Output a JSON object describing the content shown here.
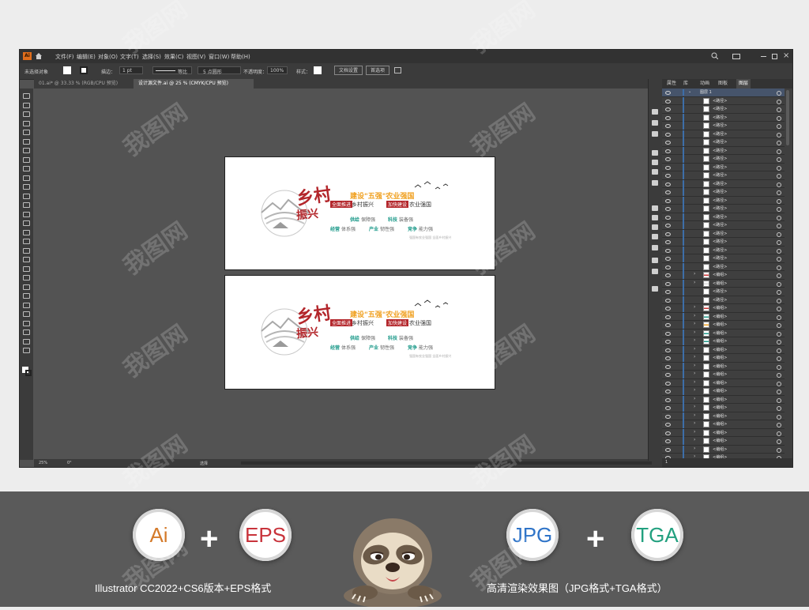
{
  "window": {
    "app_logo": "Ai",
    "menus": [
      "文件(F)",
      "编辑(E)",
      "对象(O)",
      "文字(T)",
      "选择(S)",
      "效果(C)",
      "视图(V)",
      "窗口(W)",
      "帮助(H)"
    ]
  },
  "control_bar": {
    "selection_label": "未选择对象",
    "stroke_label": "描边：",
    "stroke_value": "1 pt",
    "profile_label": "等比",
    "brush_label": "5 点圆形",
    "opacity_label": "不透明度：",
    "opacity_value": "100%",
    "style_label": "样式：",
    "doc_setup_button": "文档设置",
    "prefs_button": "首选项"
  },
  "tabs": [
    {
      "label": "01.ai* @ 33.33 % (RGB/CPU 预览)"
    },
    {
      "label": "设计源文件.ai @ 25 % (CMYK/CPU 预览)"
    }
  ],
  "status": {
    "zoom": "25%",
    "angle": "0°",
    "tool_name": "选择"
  },
  "layers_panel": {
    "tabs": [
      "属性",
      "库",
      "动画",
      "图板",
      "图层"
    ],
    "active_tab": "图层",
    "layer_name": "图层 1",
    "rows": [
      "<路径>",
      "<路径>",
      "<路径>",
      "<路径>",
      "<路径>",
      "<路径>",
      "<路径>",
      "<路径>",
      "<路径>",
      "<路径>",
      "<路径>",
      "<路径>",
      "<路径>",
      "<路径>",
      "<路径>",
      "<路径>",
      "<路径>",
      "<路径>",
      "<路径>",
      "<路径>",
      "<路径>",
      "<编组>",
      "<编组>",
      "<路径>",
      "<路径>",
      "<编组>",
      "<编组>",
      "<编组>",
      "<编组>",
      "<编组>",
      "<编组>",
      "<编组>",
      "<编组>",
      "<编组>",
      "<编组>",
      "<编组>",
      "<编组>",
      "<编组>",
      "<编组>",
      "<编组>",
      "<编组>",
      "<编组>",
      "<编组>",
      "<编组>"
    ],
    "layer_count_label": "1"
  },
  "artwork": {
    "title_big": "乡村",
    "title_sub": "振兴",
    "headline": "建设\"五强\"农业强国",
    "tag1": "全面推进",
    "slogan1": "乡村振兴",
    "tag2": "加快建设",
    "slogan2": "农业强国",
    "pair1_a": "供给",
    "pair1_b": "保障强",
    "pair2_a": "科技",
    "pair2_b": "装备强",
    "pair3_a": "经营",
    "pair3_b": "体系强",
    "pair4_a": "产业",
    "pair4_b": "韧性强",
    "pair5_a": "竞争",
    "pair5_b": "能力强",
    "small_note": "强国有农业强国 全面乡村振兴"
  },
  "promo": {
    "badge_ai": "Ai",
    "badge_eps": "EPS",
    "badge_jpg": "JPG",
    "badge_tga": "TGA",
    "plus1": "+",
    "plus2": "+",
    "caption_left": "Illustrator CC2022+CS6版本+EPS格式",
    "caption_right": "高清渲染效果图（JPG格式+TGA格式）"
  },
  "watermark": "我图网",
  "colors": {
    "red": "#b3262b",
    "orange": "#f0a01f",
    "teal": "#1d9a8a",
    "gray": "#8a8a8a",
    "layer_blue": "#3d6ea8"
  }
}
